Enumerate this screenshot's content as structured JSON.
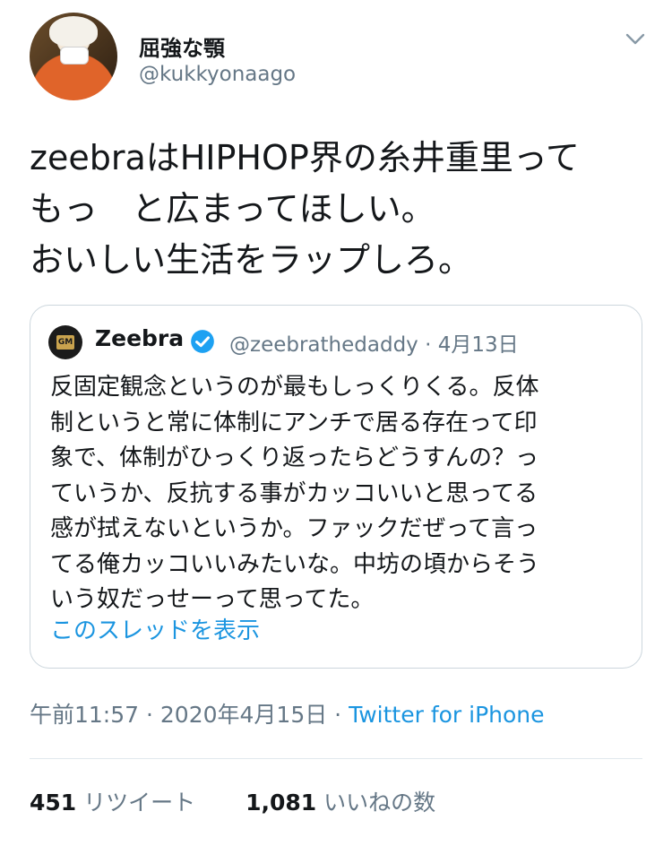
{
  "author": {
    "display_name": "屈強な顎",
    "username": "@kukkyonaago",
    "avatar_icon": "avatar-illustration"
  },
  "tweet": {
    "text": "zeebraはHIPHOP界の糸井重里って\nもっ　と広まってほしい。\nおいしい生活をラップしろ。"
  },
  "quoted_tweet": {
    "display_name": "Zeebra",
    "username": "@zeebrathedaddy",
    "separator": "·",
    "date": "4月13日",
    "verified_icon": "verified-badge-icon",
    "text": "反固定観念というのが最もしっくりくる。反体\n制というと常に体制にアンチで居る存在って印\n象で、体制がひっくり返ったらどうすんの？っ\nていうか、反抗する事がカッコいいと思ってる\n感が拭えないというか。ファックだぜって言っ\nてる俺カッコいいみたいな。中坊の頃からそう\nいう奴だっせーって思ってた。",
    "show_thread_label": "このスレッドを表示"
  },
  "meta": {
    "time": "午前11:57",
    "separator1": " · ",
    "date": "2020年4月15日",
    "separator2": " · ",
    "source": "Twitter for iPhone"
  },
  "stats": {
    "retweets_count": "451",
    "retweets_label": "リツイート",
    "likes_count": "1,081",
    "likes_label": "いいねの数"
  },
  "colors": {
    "link_blue": "#1b95e0",
    "secondary_gray": "#657786",
    "border_gray": "#ccd6dd"
  }
}
